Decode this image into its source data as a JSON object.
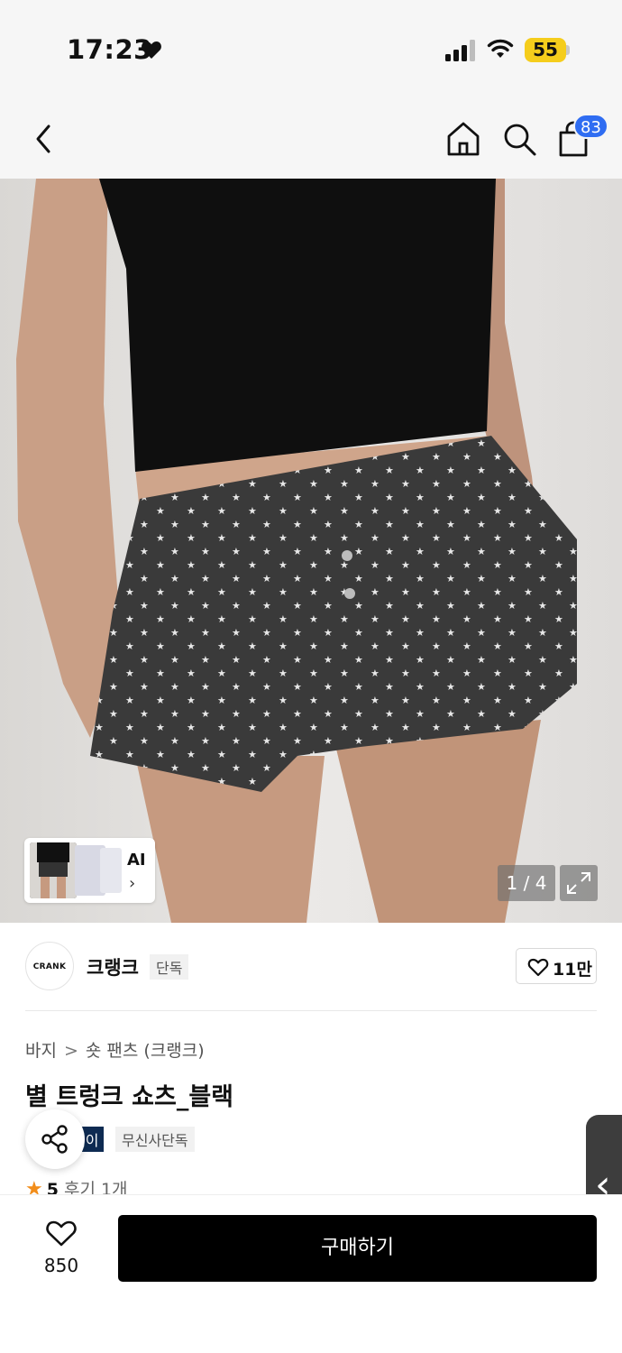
{
  "status_bar": {
    "time": "17:23",
    "battery": "55"
  },
  "header": {
    "cart_count": "83"
  },
  "gallery": {
    "ai_label": "AI",
    "counter": "1 / 4"
  },
  "brand": {
    "logo_text": "CRANK",
    "name": "크랭크",
    "tag": "단독",
    "like_count": "11만"
  },
  "breadcrumb": {
    "category": "바지",
    "subcategory": "숏 팬츠 (크랭크)"
  },
  "product": {
    "title": "별 트렁크 쇼츠_블랙",
    "badge_dark": "페이",
    "badge_light": "무신사단독",
    "rating": "5",
    "reviews": "후기 1개"
  },
  "bottom_bar": {
    "wish_count": "850",
    "buy_label": "구매하기"
  },
  "colors": {
    "accent_blue": "#2f6df2",
    "battery_yellow": "#f5cd1c",
    "star_orange": "#f28d1a",
    "badge_navy": "#0e2b52"
  }
}
